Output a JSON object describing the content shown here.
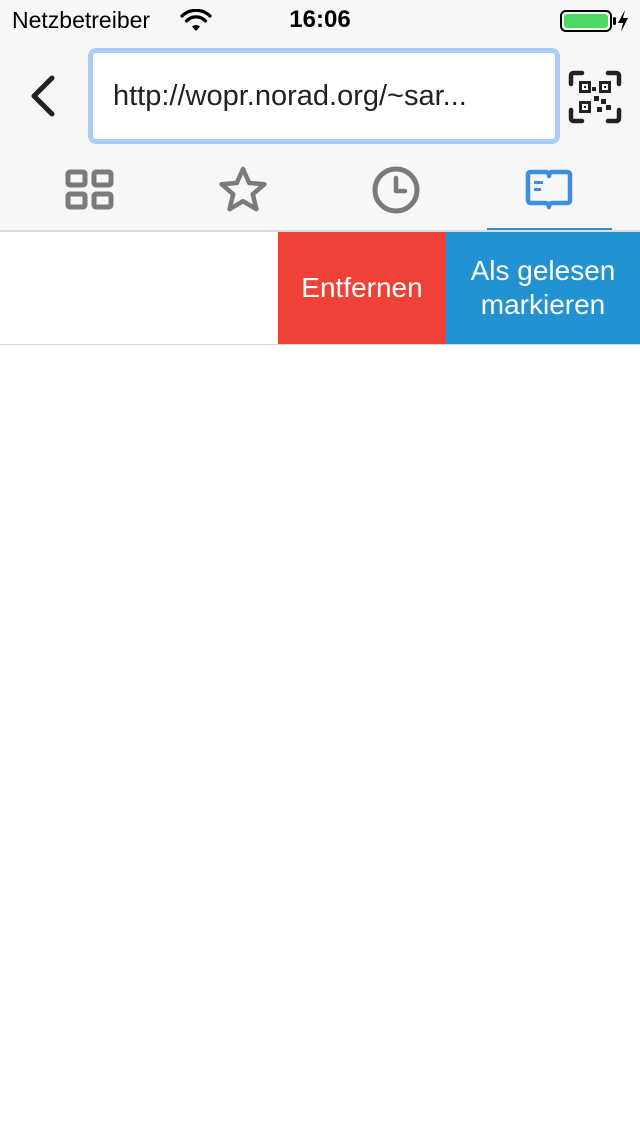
{
  "status_bar": {
    "carrier": "Netzbetreiber",
    "time": "16:06",
    "battery_level_percent": 100,
    "charging": true
  },
  "nav_bar": {
    "back_icon": "chevron-left-icon",
    "url": "http://wopr.norad.org/~sar...",
    "qr_icon": "qr-code-scan-icon"
  },
  "tabs": [
    {
      "name": "top-sites",
      "icon": "grid-icon",
      "selected": false
    },
    {
      "name": "bookmarks",
      "icon": "star-icon",
      "selected": false
    },
    {
      "name": "history",
      "icon": "clock-icon",
      "selected": false
    },
    {
      "name": "reading-list",
      "icon": "book-icon",
      "selected": true
    }
  ],
  "row_actions": {
    "remove_label": "Entfernen",
    "mark_read_label_line1": "Als gelesen",
    "mark_read_label_line2": "markieren"
  },
  "colors": {
    "accent": "#2d8fd9",
    "remove": "#ef4136",
    "mark_read": "#2292d3",
    "url_border": "#a9cdf3",
    "icon_gray": "#7a7a7a"
  }
}
